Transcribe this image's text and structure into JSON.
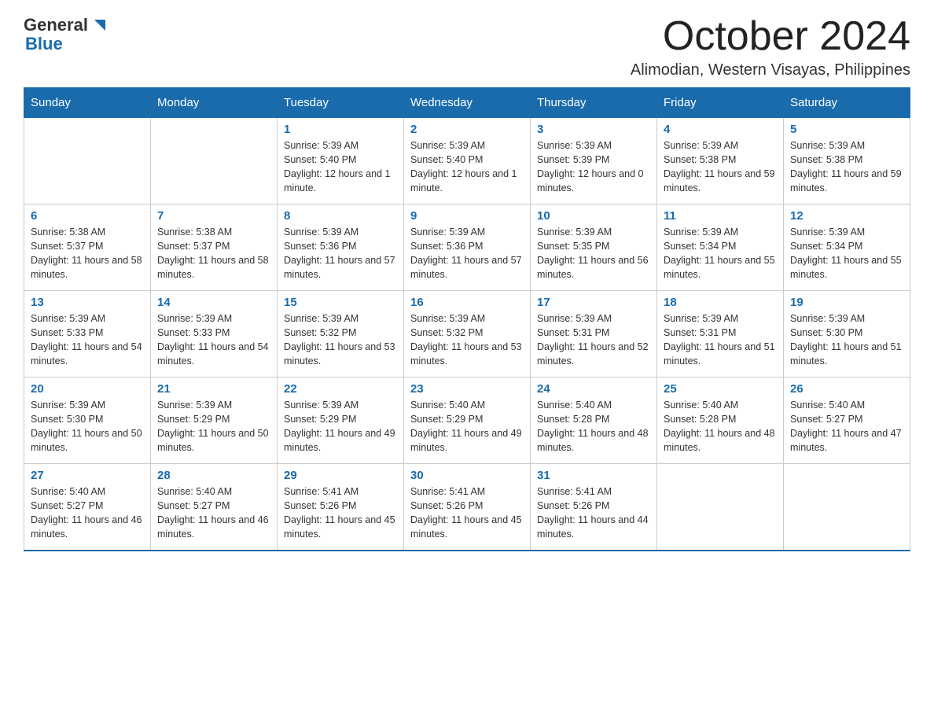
{
  "header": {
    "logo_general": "General",
    "logo_blue": "Blue",
    "month_title": "October 2024",
    "location": "Alimodian, Western Visayas, Philippines"
  },
  "weekdays": [
    "Sunday",
    "Monday",
    "Tuesday",
    "Wednesday",
    "Thursday",
    "Friday",
    "Saturday"
  ],
  "weeks": [
    [
      {
        "day": "",
        "sunrise": "",
        "sunset": "",
        "daylight": ""
      },
      {
        "day": "",
        "sunrise": "",
        "sunset": "",
        "daylight": ""
      },
      {
        "day": "1",
        "sunrise": "Sunrise: 5:39 AM",
        "sunset": "Sunset: 5:40 PM",
        "daylight": "Daylight: 12 hours and 1 minute."
      },
      {
        "day": "2",
        "sunrise": "Sunrise: 5:39 AM",
        "sunset": "Sunset: 5:40 PM",
        "daylight": "Daylight: 12 hours and 1 minute."
      },
      {
        "day": "3",
        "sunrise": "Sunrise: 5:39 AM",
        "sunset": "Sunset: 5:39 PM",
        "daylight": "Daylight: 12 hours and 0 minutes."
      },
      {
        "day": "4",
        "sunrise": "Sunrise: 5:39 AM",
        "sunset": "Sunset: 5:38 PM",
        "daylight": "Daylight: 11 hours and 59 minutes."
      },
      {
        "day": "5",
        "sunrise": "Sunrise: 5:39 AM",
        "sunset": "Sunset: 5:38 PM",
        "daylight": "Daylight: 11 hours and 59 minutes."
      }
    ],
    [
      {
        "day": "6",
        "sunrise": "Sunrise: 5:38 AM",
        "sunset": "Sunset: 5:37 PM",
        "daylight": "Daylight: 11 hours and 58 minutes."
      },
      {
        "day": "7",
        "sunrise": "Sunrise: 5:38 AM",
        "sunset": "Sunset: 5:37 PM",
        "daylight": "Daylight: 11 hours and 58 minutes."
      },
      {
        "day": "8",
        "sunrise": "Sunrise: 5:39 AM",
        "sunset": "Sunset: 5:36 PM",
        "daylight": "Daylight: 11 hours and 57 minutes."
      },
      {
        "day": "9",
        "sunrise": "Sunrise: 5:39 AM",
        "sunset": "Sunset: 5:36 PM",
        "daylight": "Daylight: 11 hours and 57 minutes."
      },
      {
        "day": "10",
        "sunrise": "Sunrise: 5:39 AM",
        "sunset": "Sunset: 5:35 PM",
        "daylight": "Daylight: 11 hours and 56 minutes."
      },
      {
        "day": "11",
        "sunrise": "Sunrise: 5:39 AM",
        "sunset": "Sunset: 5:34 PM",
        "daylight": "Daylight: 11 hours and 55 minutes."
      },
      {
        "day": "12",
        "sunrise": "Sunrise: 5:39 AM",
        "sunset": "Sunset: 5:34 PM",
        "daylight": "Daylight: 11 hours and 55 minutes."
      }
    ],
    [
      {
        "day": "13",
        "sunrise": "Sunrise: 5:39 AM",
        "sunset": "Sunset: 5:33 PM",
        "daylight": "Daylight: 11 hours and 54 minutes."
      },
      {
        "day": "14",
        "sunrise": "Sunrise: 5:39 AM",
        "sunset": "Sunset: 5:33 PM",
        "daylight": "Daylight: 11 hours and 54 minutes."
      },
      {
        "day": "15",
        "sunrise": "Sunrise: 5:39 AM",
        "sunset": "Sunset: 5:32 PM",
        "daylight": "Daylight: 11 hours and 53 minutes."
      },
      {
        "day": "16",
        "sunrise": "Sunrise: 5:39 AM",
        "sunset": "Sunset: 5:32 PM",
        "daylight": "Daylight: 11 hours and 53 minutes."
      },
      {
        "day": "17",
        "sunrise": "Sunrise: 5:39 AM",
        "sunset": "Sunset: 5:31 PM",
        "daylight": "Daylight: 11 hours and 52 minutes."
      },
      {
        "day": "18",
        "sunrise": "Sunrise: 5:39 AM",
        "sunset": "Sunset: 5:31 PM",
        "daylight": "Daylight: 11 hours and 51 minutes."
      },
      {
        "day": "19",
        "sunrise": "Sunrise: 5:39 AM",
        "sunset": "Sunset: 5:30 PM",
        "daylight": "Daylight: 11 hours and 51 minutes."
      }
    ],
    [
      {
        "day": "20",
        "sunrise": "Sunrise: 5:39 AM",
        "sunset": "Sunset: 5:30 PM",
        "daylight": "Daylight: 11 hours and 50 minutes."
      },
      {
        "day": "21",
        "sunrise": "Sunrise: 5:39 AM",
        "sunset": "Sunset: 5:29 PM",
        "daylight": "Daylight: 11 hours and 50 minutes."
      },
      {
        "day": "22",
        "sunrise": "Sunrise: 5:39 AM",
        "sunset": "Sunset: 5:29 PM",
        "daylight": "Daylight: 11 hours and 49 minutes."
      },
      {
        "day": "23",
        "sunrise": "Sunrise: 5:40 AM",
        "sunset": "Sunset: 5:29 PM",
        "daylight": "Daylight: 11 hours and 49 minutes."
      },
      {
        "day": "24",
        "sunrise": "Sunrise: 5:40 AM",
        "sunset": "Sunset: 5:28 PM",
        "daylight": "Daylight: 11 hours and 48 minutes."
      },
      {
        "day": "25",
        "sunrise": "Sunrise: 5:40 AM",
        "sunset": "Sunset: 5:28 PM",
        "daylight": "Daylight: 11 hours and 48 minutes."
      },
      {
        "day": "26",
        "sunrise": "Sunrise: 5:40 AM",
        "sunset": "Sunset: 5:27 PM",
        "daylight": "Daylight: 11 hours and 47 minutes."
      }
    ],
    [
      {
        "day": "27",
        "sunrise": "Sunrise: 5:40 AM",
        "sunset": "Sunset: 5:27 PM",
        "daylight": "Daylight: 11 hours and 46 minutes."
      },
      {
        "day": "28",
        "sunrise": "Sunrise: 5:40 AM",
        "sunset": "Sunset: 5:27 PM",
        "daylight": "Daylight: 11 hours and 46 minutes."
      },
      {
        "day": "29",
        "sunrise": "Sunrise: 5:41 AM",
        "sunset": "Sunset: 5:26 PM",
        "daylight": "Daylight: 11 hours and 45 minutes."
      },
      {
        "day": "30",
        "sunrise": "Sunrise: 5:41 AM",
        "sunset": "Sunset: 5:26 PM",
        "daylight": "Daylight: 11 hours and 45 minutes."
      },
      {
        "day": "31",
        "sunrise": "Sunrise: 5:41 AM",
        "sunset": "Sunset: 5:26 PM",
        "daylight": "Daylight: 11 hours and 44 minutes."
      },
      {
        "day": "",
        "sunrise": "",
        "sunset": "",
        "daylight": ""
      },
      {
        "day": "",
        "sunrise": "",
        "sunset": "",
        "daylight": ""
      }
    ]
  ]
}
